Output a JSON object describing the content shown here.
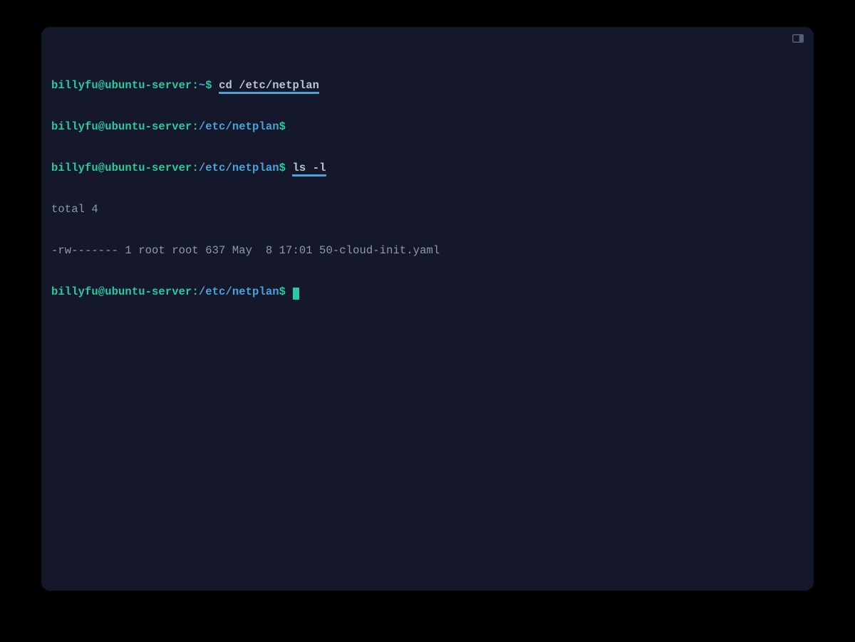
{
  "lines": {
    "l1": {
      "userhost": "billyfu@ubuntu-server",
      "colon": ":",
      "path": "~",
      "symbol": "$",
      "cmd_prefix": " ",
      "cmd_underlined": "cd /etc/netplan"
    },
    "l2": {
      "userhost": "billyfu@ubuntu-server",
      "colon": ":",
      "path": "/etc/netplan",
      "symbol": "$"
    },
    "l3": {
      "userhost": "billyfu@ubuntu-server",
      "colon": ":",
      "path": "/etc/netplan",
      "symbol": "$",
      "cmd_prefix": " ",
      "cmd_underlined": "ls -l"
    },
    "l4": {
      "output": "total 4"
    },
    "l5": {
      "output": "-rw------- 1 root root 637 May  8 17:01 50-cloud-init.yaml"
    },
    "l6": {
      "userhost": "billyfu@ubuntu-server",
      "colon": ":",
      "path": "/etc/netplan",
      "symbol": "$",
      "cmd_prefix": " "
    }
  }
}
